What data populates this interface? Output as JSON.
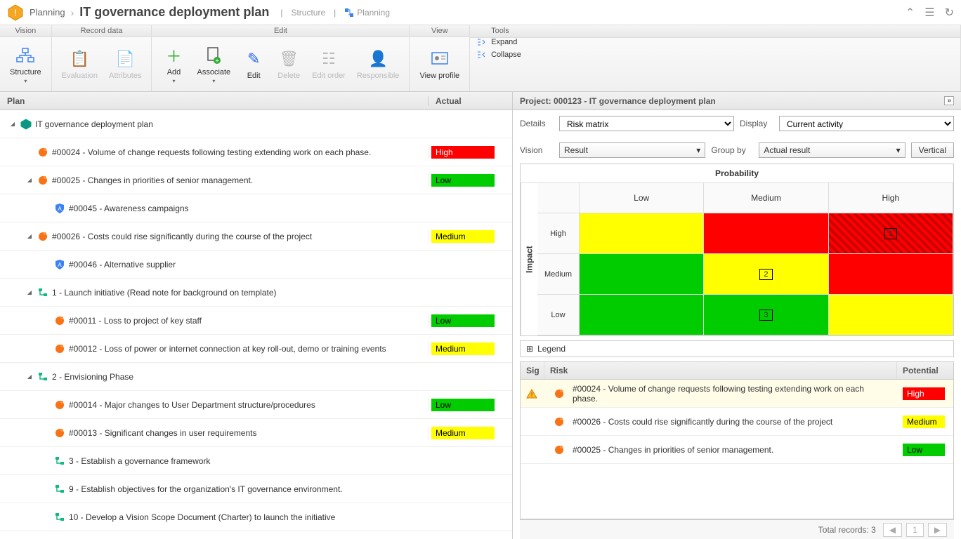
{
  "breadcrumb": {
    "section": "Planning",
    "title": "IT governance deployment plan",
    "sub1": "Structure",
    "sub2": "Planning"
  },
  "ribbon": {
    "groups": {
      "vision": {
        "title": "Vision",
        "structure": "Structure"
      },
      "record": {
        "title": "Record data",
        "evaluation": "Evaluation",
        "attributes": "Attributes"
      },
      "edit": {
        "title": "Edit",
        "add": "Add",
        "associate": "Associate",
        "edit": "Edit",
        "delete": "Delete",
        "editorder": "Edit order",
        "responsible": "Responsible"
      },
      "view": {
        "title": "View",
        "viewprofile": "View profile"
      },
      "tools": {
        "title": "Tools",
        "expand": "Expand",
        "collapse": "Collapse"
      }
    }
  },
  "left": {
    "col_plan": "Plan",
    "col_actual": "Actual",
    "rows": [
      {
        "indent": 0,
        "toggle": "▣",
        "icon": "cube",
        "text": "IT governance deployment plan",
        "actual": ""
      },
      {
        "indent": 1,
        "toggle": "",
        "icon": "risk",
        "text": "#00024 - Volume of change requests following testing extending work on each phase.",
        "actual": "High",
        "cls": "high"
      },
      {
        "indent": 1,
        "toggle": "▣",
        "icon": "risk",
        "text": "#00025 - Changes in priorities of senior management.",
        "actual": "Low",
        "cls": "low"
      },
      {
        "indent": 2,
        "toggle": "",
        "icon": "shield",
        "text": "#00045 - Awareness campaigns",
        "actual": ""
      },
      {
        "indent": 1,
        "toggle": "▣",
        "icon": "risk",
        "text": "#00026 - Costs could rise significantly during the course of the project",
        "actual": "Medium",
        "cls": "medium"
      },
      {
        "indent": 2,
        "toggle": "",
        "icon": "shield",
        "text": "#00046 - Alternative supplier",
        "actual": ""
      },
      {
        "indent": 1,
        "toggle": "▣",
        "icon": "phase",
        "text": "1 - Launch initiative (Read note for background on template)",
        "actual": ""
      },
      {
        "indent": 2,
        "toggle": "",
        "icon": "risk",
        "text": "#00011 - Loss to project of key staff",
        "actual": "Low",
        "cls": "low"
      },
      {
        "indent": 2,
        "toggle": "",
        "icon": "risk",
        "text": "#00012 - Loss of power or internet connection at key roll-out, demo or training events",
        "actual": "Medium",
        "cls": "medium"
      },
      {
        "indent": 1,
        "toggle": "▣",
        "icon": "phase",
        "text": "2 - Envisioning Phase",
        "actual": ""
      },
      {
        "indent": 2,
        "toggle": "",
        "icon": "risk",
        "text": "#00014 - Major changes to User Department structure/procedures",
        "actual": "Low",
        "cls": "low"
      },
      {
        "indent": 2,
        "toggle": "",
        "icon": "risk",
        "text": "#00013 - Significant changes in user requirements",
        "actual": "Medium",
        "cls": "medium"
      },
      {
        "indent": 2,
        "toggle": "",
        "icon": "phase",
        "text": "3 - Establish a governance framework",
        "actual": ""
      },
      {
        "indent": 2,
        "toggle": "",
        "icon": "phase",
        "text": "9 - Establish objectives for the organization's IT governance environment.",
        "actual": ""
      },
      {
        "indent": 2,
        "toggle": "",
        "icon": "phase",
        "text": "10 - Develop a Vision Scope Document (Charter) to launch the initiative",
        "actual": ""
      }
    ]
  },
  "right": {
    "project_title": "Project: 000123 - IT governance deployment plan",
    "labels": {
      "details": "Details",
      "display": "Display",
      "vision": "Vision",
      "groupby": "Group by",
      "vertical": "Vertical"
    },
    "selects": {
      "details": "Risk matrix",
      "display": "Current activity",
      "vision": "Result",
      "groupby": "Actual result"
    },
    "matrix": {
      "prob_title": "Probability",
      "impact_title": "Impact",
      "cols": [
        "Low",
        "Medium",
        "High"
      ],
      "rows": [
        "High",
        "Medium",
        "Low"
      ],
      "cells": [
        [
          "yellow",
          "red",
          "red-hatch:1"
        ],
        [
          "green",
          "yellow:2",
          "red"
        ],
        [
          "green",
          "green:3",
          "yellow"
        ]
      ]
    },
    "legend": "Legend",
    "risk_table": {
      "col_sig": "Sig",
      "col_risk": "Risk",
      "col_potential": "Potential",
      "rows": [
        {
          "sig": "warn",
          "text": "#00024 - Volume of change requests following testing extending work on each phase.",
          "pot": "High",
          "cls": "high",
          "hl": true
        },
        {
          "sig": "",
          "text": "#00026 - Costs could rise significantly during the course of the project",
          "pot": "Medium",
          "cls": "medium",
          "hl": false
        },
        {
          "sig": "",
          "text": "#00025 - Changes in priorities of senior management.",
          "pot": "Low",
          "cls": "low",
          "hl": false
        }
      ],
      "footer": "Total records: 3",
      "page": "1"
    }
  }
}
